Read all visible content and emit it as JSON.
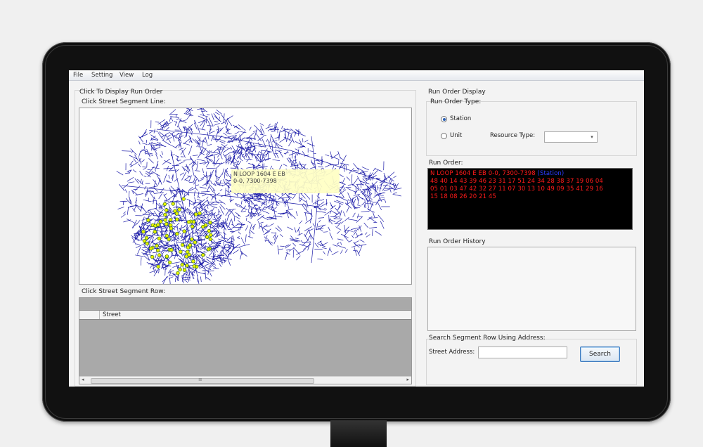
{
  "menu": [
    "File",
    "Setting",
    "View",
    "Log"
  ],
  "left": {
    "section_title": "Click To Display Run Order",
    "map_label": "Click Street Segment Line:",
    "tooltip_lines": [
      "N LOOP 1604 E EB",
      "0-0, 7300-7398"
    ],
    "row_label": "Click Street Segment Row:",
    "grid_column": "Street",
    "scroll_left": "◂",
    "scroll_right": "▸",
    "scroll_thumb_grip": "≡"
  },
  "right": {
    "section_title": "Run Order Display",
    "type_label": "Run Order Type:",
    "options": [
      {
        "label": "Station",
        "checked": true
      },
      {
        "label": "Unit",
        "checked": false
      }
    ],
    "resource_type_label": "Resource Type:",
    "combo_arrow": "▾",
    "run_order_label": "Run Order:",
    "run_order_text": "N LOOP 1604 E EB  0-0, 7300-7398",
    "run_order_tag": "(Station)",
    "run_order_lines": [
      "48 40 14 43 39 46 23 31 17 51 24 34 28 38 37 19 06 04",
      "05 01 03 47 42 32 27 11 07 30 13 10 49 09 35 41 29 16",
      "15 18 08 26 20 21 45"
    ],
    "history_label": "Run Order History",
    "search_title": "Search Segment Row Using Address:",
    "address_label": "Street Address:",
    "address_value": "",
    "search_button": "Search"
  },
  "colors": {
    "street_lines": "#1b1ba8",
    "station_markers": "#e8f000",
    "run_order_text": "#ff1a1a",
    "run_order_tag": "#2b3cff"
  }
}
